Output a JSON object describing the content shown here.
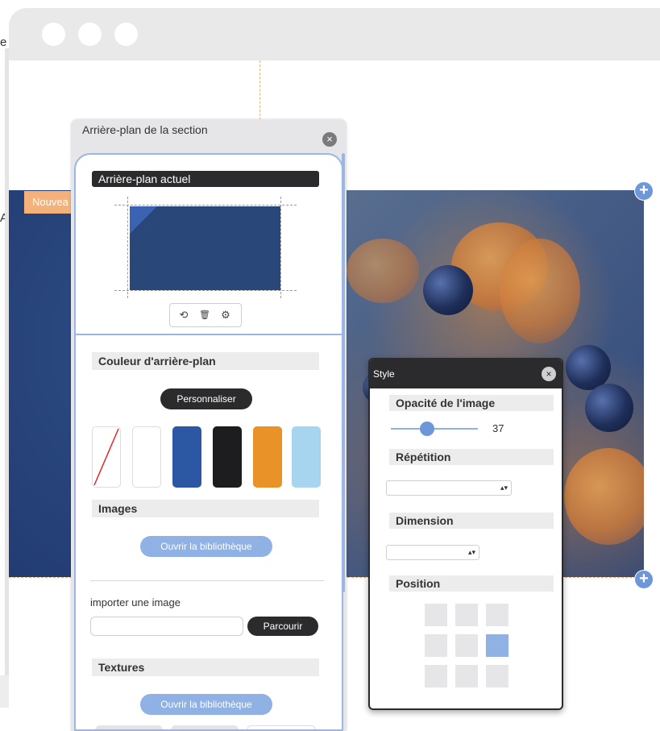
{
  "outside": {
    "text_top": "e",
    "text_mid": "A"
  },
  "hero": {
    "new_label": "Nouvea"
  },
  "section_panel": {
    "title": "Arrière-plan de la section",
    "close_icon": "×",
    "current_bg_label": "Arrière-plan actuel",
    "tools": {
      "reset_icon": "⟲",
      "delete_icon": "🗑",
      "settings_icon": "⚙"
    },
    "bg_color_label": "Couleur d'arrière-plan",
    "customize_label": "Personnaliser",
    "swatches": [
      {
        "name": "none",
        "color": "#ffffff"
      },
      {
        "name": "white",
        "color": "#ffffff"
      },
      {
        "name": "blue",
        "color": "#2c58a3"
      },
      {
        "name": "black",
        "color": "#1d1d1f"
      },
      {
        "name": "orange",
        "color": "#e99228"
      },
      {
        "name": "light-blue",
        "color": "#a7d5ef"
      }
    ],
    "images_label": "Images",
    "open_library_label": "Ouvrir la bibliothèque",
    "import_label": "importer une image",
    "import_input_value": "",
    "browse_label": "Parcourir",
    "textures_label": "Textures",
    "open_library_label_2": "Ouvrir la bibliothèque"
  },
  "style_dialog": {
    "title": "Style",
    "close_icon": "×",
    "opacity_label": "Opacité de l'image",
    "opacity_value": "37",
    "repetition_label": "Répétition",
    "repetition_value": "",
    "dimension_label": "Dimension",
    "dimension_value": "",
    "select_arrow": "▴▾",
    "position_label": "Position",
    "position_grid": [
      [
        false,
        false,
        false
      ],
      [
        false,
        false,
        true
      ],
      [
        false,
        false,
        false
      ]
    ]
  },
  "colors": {
    "accent_blue": "#8fb1e3",
    "dark": "#2b2b2d",
    "orange": "#f4b27a"
  }
}
